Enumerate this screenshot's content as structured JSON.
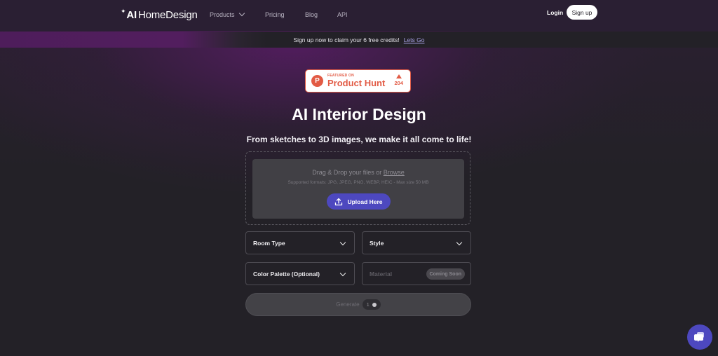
{
  "header": {
    "logo": {
      "prefix": "AI",
      "name": "HomeDesign"
    },
    "nav": [
      {
        "label": "Products",
        "has_dropdown": true
      },
      {
        "label": "Pricing"
      },
      {
        "label": "Blog"
      },
      {
        "label": "API"
      }
    ],
    "login_label": "Login",
    "signup_label": "Sign up"
  },
  "banner": {
    "text": "Sign up now to claim your 6 free credits!",
    "link_label": "Lets Go"
  },
  "product_hunt": {
    "logo_letter": "P",
    "featured_label": "FEATURED ON",
    "name": "Product Hunt",
    "votes": "204"
  },
  "hero": {
    "title": "AI Interior Design",
    "subtitle": "From sketches to 3D images, we make it all come to life!"
  },
  "upload": {
    "prompt": "Drag & Drop your files or",
    "browse_label": "Browse",
    "formats": "Supported formats: JPG, JPEG, PNG, WEBP, HEIC - Max size 50 MB",
    "button_label": "Upload Here"
  },
  "form": {
    "room_type": "Room Type",
    "style": "Style",
    "color_palette": "Color Palette (Optional)",
    "material": "Material",
    "material_badge": "Coming Soon"
  },
  "generate": {
    "label": "Generate",
    "credits": "1"
  },
  "colors": {
    "accent": "#4d48bf",
    "product_hunt": "#e25b45",
    "background": "#232127"
  }
}
